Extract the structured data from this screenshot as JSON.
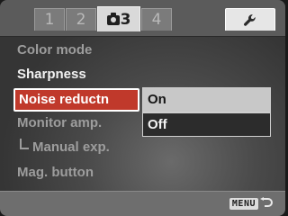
{
  "tabs": [
    {
      "label": "1"
    },
    {
      "label": "2"
    },
    {
      "label": "3"
    },
    {
      "label": "4"
    }
  ],
  "setup_tab_icon": "wrench-icon",
  "menu": {
    "items": [
      {
        "label": "Color mode"
      },
      {
        "label": "Sharpness"
      },
      {
        "label": "Noise reductn"
      },
      {
        "label": "Monitor amp."
      },
      {
        "label": "Manual exp."
      },
      {
        "label": "Mag. button"
      }
    ],
    "selected_index": 2
  },
  "options": {
    "items": [
      {
        "label": "On"
      },
      {
        "label": "Off"
      }
    ],
    "highlighted_index": 0
  },
  "footer": {
    "menu_key_label": "MENU",
    "return_icon": "return-arrow-icon"
  },
  "colors": {
    "selection": "#c0392b",
    "tab_active": "#d9d9d9"
  }
}
